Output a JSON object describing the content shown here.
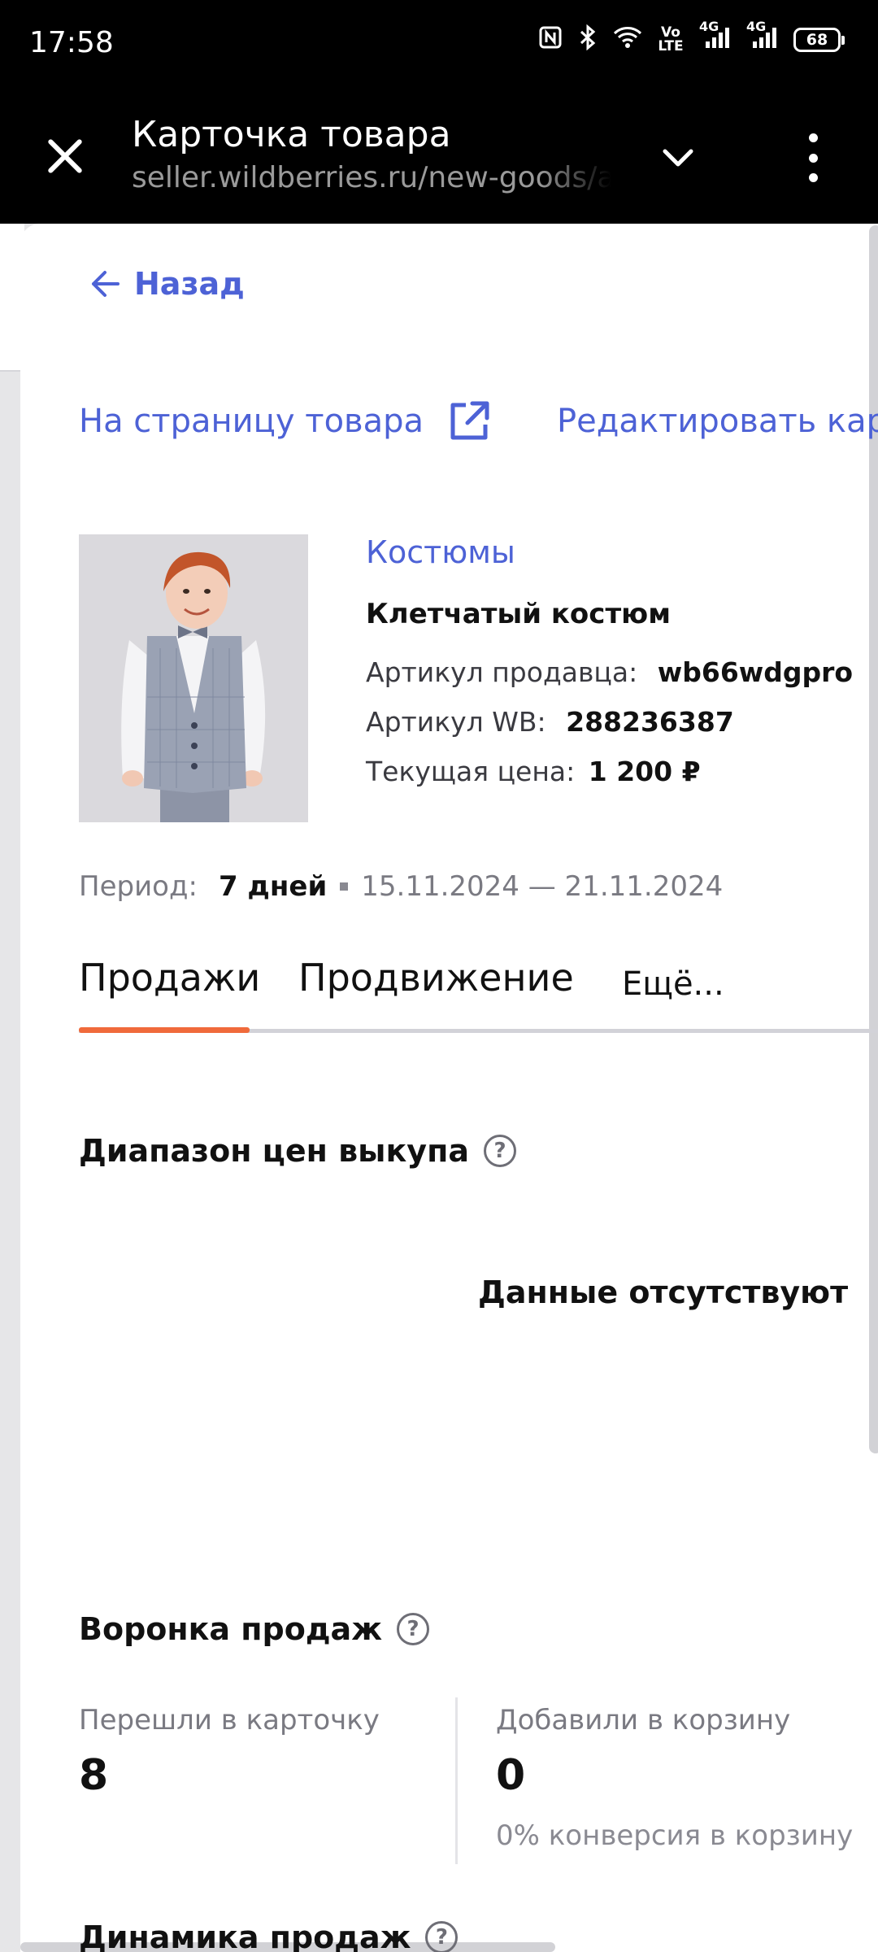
{
  "status_bar": {
    "time": "17:58",
    "icons": [
      "nfc-icon",
      "bluetooth-icon",
      "wifi-icon",
      "volte-icon",
      "signal-4g-icon",
      "signal-4g-icon"
    ],
    "volte_label": "Vo LTE",
    "net_label_1": "4G",
    "net_label_2": "4G",
    "battery": "68"
  },
  "browser": {
    "title": "Карточка товара",
    "url": "seller.wildberries.ru/new-goods/all-goods"
  },
  "nav": {
    "back_label": "Назад",
    "product_page_link": "На страницу товара",
    "edit_card_link": "Редактировать карточку"
  },
  "product": {
    "category": "Костюмы",
    "name": "Клетчатый костюм",
    "seller_article_label": "Артикул продавца:",
    "seller_article_value": "wb66wdgpro",
    "wb_article_label": "Артикул WB:",
    "wb_article_value": "288236387",
    "price_label": "Текущая цена:",
    "price_value": "1 200 ₽"
  },
  "period": {
    "label": "Период:",
    "days": "7 дней",
    "range": "15.11.2024 — 21.11.2024"
  },
  "tabs": [
    {
      "label": "Продажи",
      "active": true
    },
    {
      "label": "Продвижение",
      "active": false
    },
    {
      "label": "Ещё...",
      "active": false
    }
  ],
  "price_range": {
    "title": "Диапазон цен выкупа",
    "empty_text": "Данные отсутствуют"
  },
  "funnel": {
    "title": "Воронка продаж",
    "card_visits_label": "Перешли в карточку",
    "card_visits_value": "8",
    "added_to_cart_label": "Добавили в корзину",
    "added_to_cart_value": "0",
    "cart_conversion": "0% конверсия в корзину"
  },
  "next_section_title": "Динамика продаж",
  "colors": {
    "accent": "#4d62d6",
    "active_tab": "#f06a3b"
  }
}
